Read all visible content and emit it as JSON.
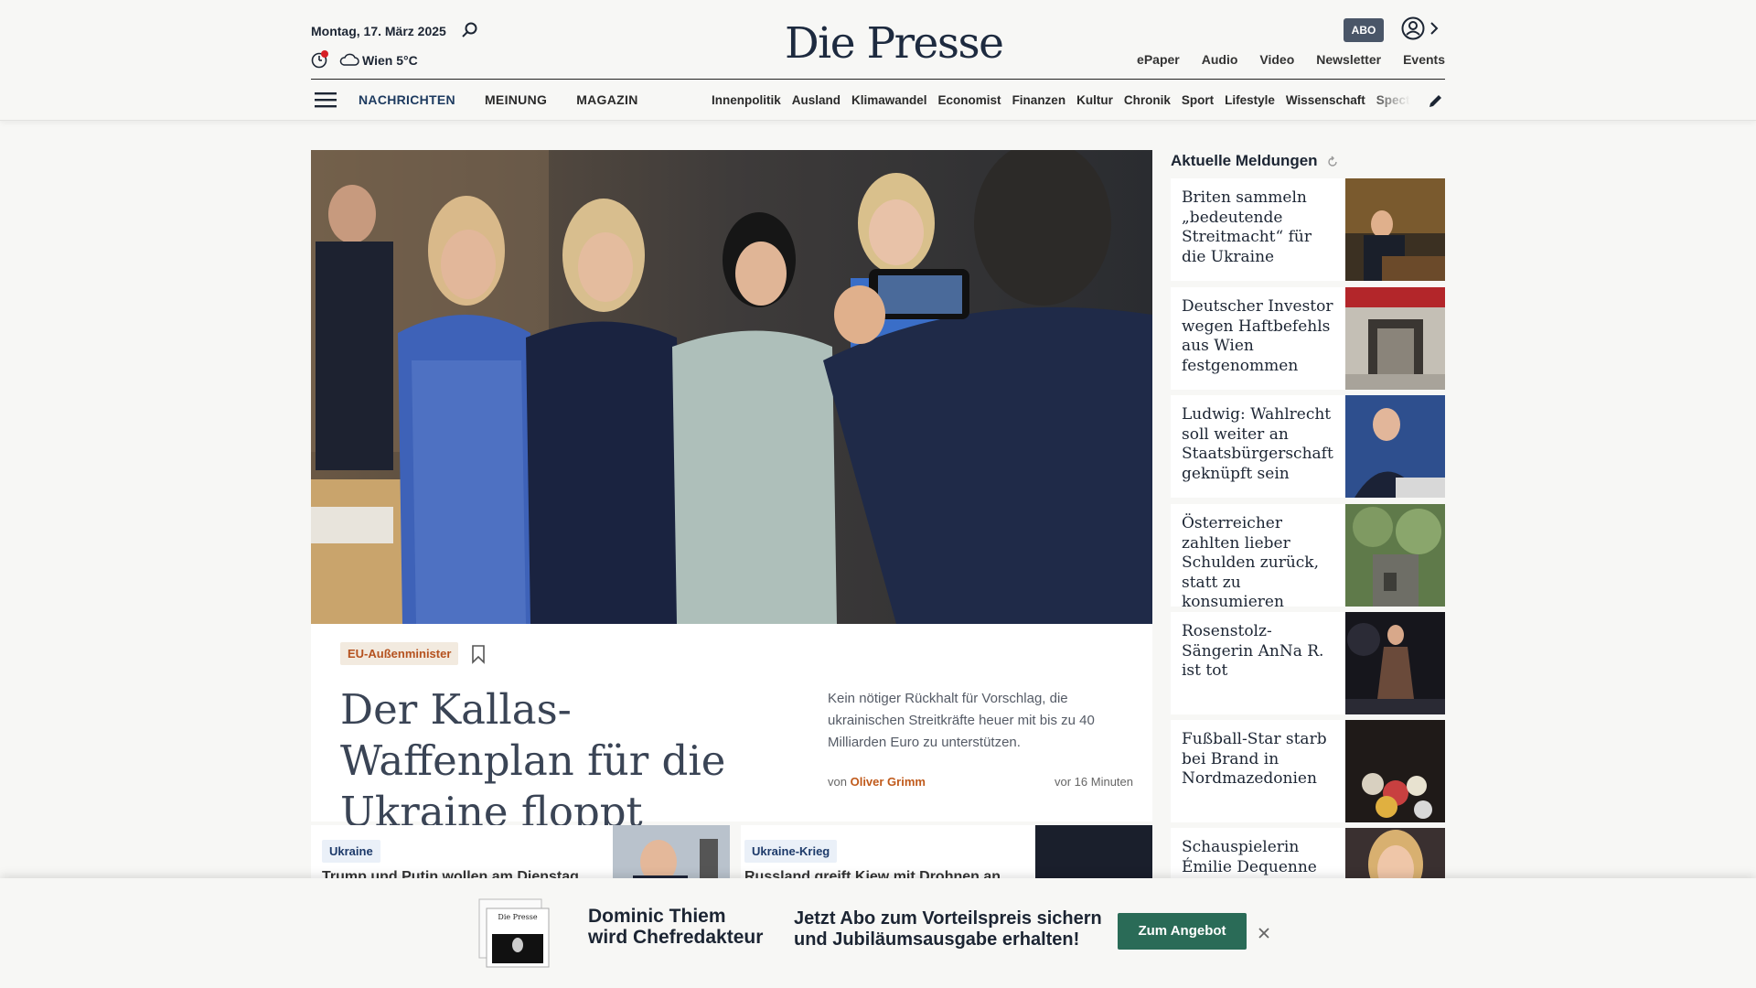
{
  "header": {
    "date": "Montag, 17. März 2025",
    "weather": "Wien 5°C",
    "logo": "Die Presse",
    "abo_label": "ABO",
    "top_links": [
      "ePaper",
      "Audio",
      "Video",
      "Newsletter",
      "Events"
    ]
  },
  "nav": {
    "main": [
      "NACHRICHTEN",
      "MEINUNG",
      "MAGAZIN"
    ],
    "sub": [
      "Innenpolitik",
      "Ausland",
      "Klimawandel",
      "Economist",
      "Finanzen",
      "Kultur",
      "Chronik",
      "Sport",
      "Lifestyle",
      "Wissenschaft",
      "Spectrum"
    ]
  },
  "hero": {
    "tag": "EU-Außenminister",
    "title": "Der Kallas-Waffenplan für die Ukraine floppt",
    "teaser": "Kein nötiger Rückhalt für Vorschlag, die ukrainischen Streitkräfte heuer mit bis zu 40 Milliarden Euro zu unterstützen.",
    "byline_prefix": "von",
    "author": "Oliver Grimm",
    "time": "vor 16 Minuten"
  },
  "lower": [
    {
      "tag": "Ukraine",
      "title": "Trump und Putin wollen am Dienstag"
    },
    {
      "tag": "Ukraine-Krieg",
      "title": "Russland greift Kiew mit Drohnen an"
    }
  ],
  "sidebar": {
    "heading": "Aktuelle Meldungen",
    "items": [
      "Briten sammeln „bedeutende Streitmacht“ für die Ukraine",
      "Deutscher Investor wegen Haftbefehls aus Wien festgenommen",
      "Ludwig: Wahlrecht soll weiter an Staatsbürgerschaft geknüpft sein",
      "Österreicher zahlten lieber Schulden zurück, statt zu konsumieren",
      "Rosenstolz-Sängerin AnNa R. ist tot",
      "Fußball-Star starb bei Brand in Nordmazedonien",
      "Schauspielerin Émilie Dequenne mit"
    ]
  },
  "banner": {
    "left_line1": "Dominic Thiem",
    "left_line2": "wird Chefredakteur",
    "right_line1": "Jetzt Abo zum Vorteilspreis sichern",
    "right_line2": "und Jubiläumsausgabe erhalten!",
    "button": "Zum Angebot",
    "paper_logo": "Die Presse"
  },
  "colors": {
    "accent_orange": "#c05a1b",
    "nav_blue": "#1d3a5f",
    "button_green": "#2a6b57",
    "abo_gray": "#4a5668"
  }
}
